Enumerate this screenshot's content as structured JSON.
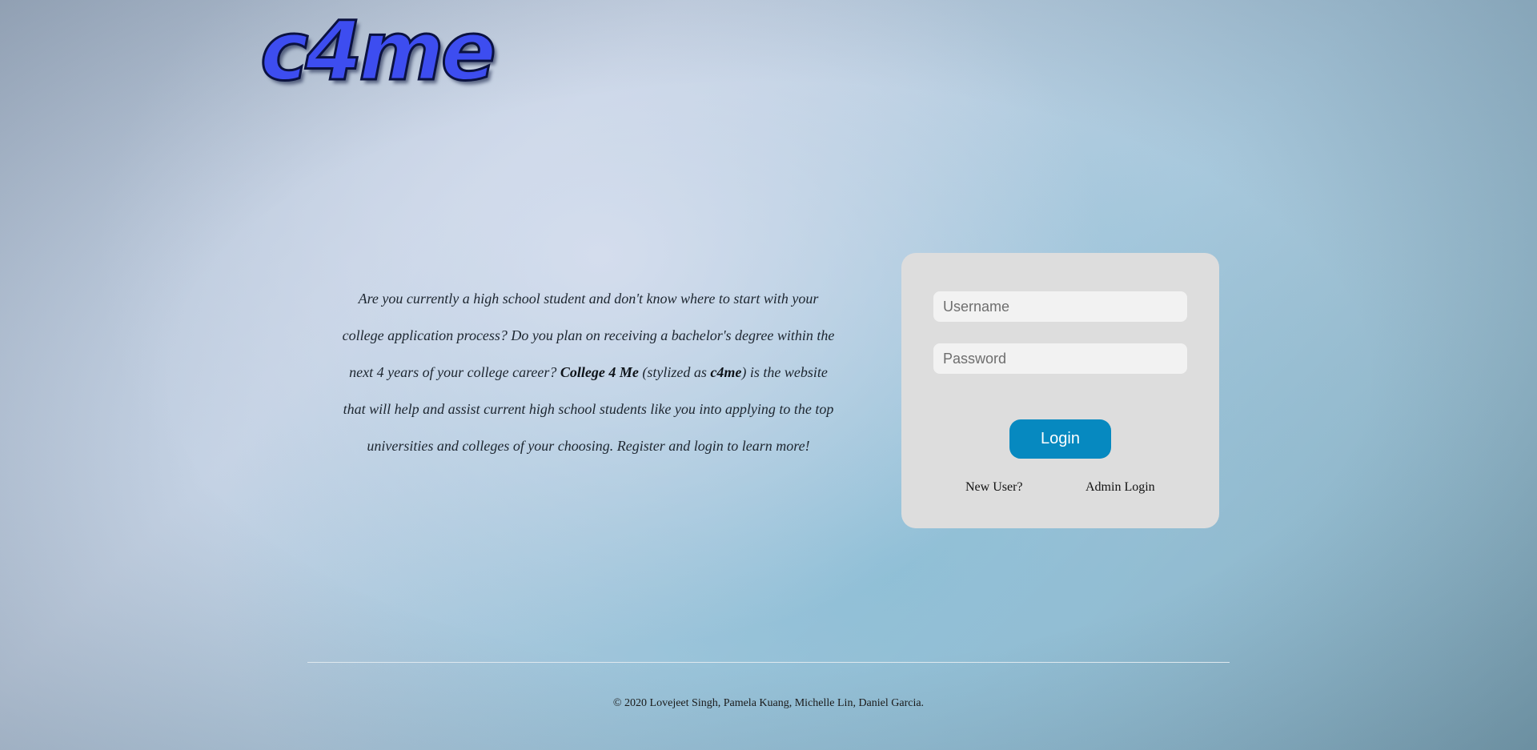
{
  "brand": {
    "logo_text": "c4me"
  },
  "intro": {
    "text_before_brand": "Are you currently a high school student and don't know where to start with your college application process? Do you plan on receiving a bachelor's degree within the next 4 years of your college career? ",
    "brand_full": "College 4 Me",
    "text_stylized_prefix": " (stylized as ",
    "brand_short": "c4me",
    "text_after_brand": ") is the website that will help and assist current high school students like you into applying to the top universities and colleges of your choosing. Register and login to learn more!"
  },
  "login": {
    "username_placeholder": "Username",
    "username_value": "",
    "password_placeholder": "Password",
    "password_value": "",
    "login_button_label": "Login",
    "new_user_link": "New User?",
    "admin_login_link": "Admin Login"
  },
  "footer": {
    "copyright": "© 2020 Lovejeet Singh, Pamela Kuang, Michelle Lin, Daniel Garcia."
  },
  "colors": {
    "logo_fill": "#3d4df0",
    "login_button": "#0689c0",
    "card_background": "#dddddd"
  }
}
